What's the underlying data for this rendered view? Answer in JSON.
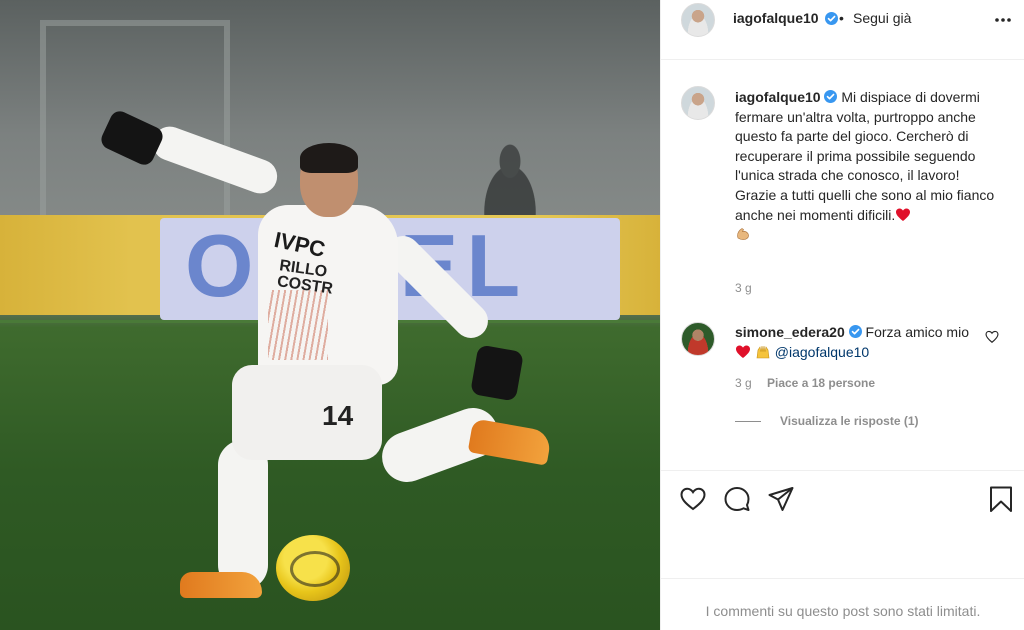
{
  "post": {
    "photo": {
      "banner_text": "OLGEL",
      "shirt_sponsor": "IVPC",
      "shirt_sponsor2": "RILLO\nCOSTR",
      "shirt_number": "14"
    }
  },
  "header": {
    "username": "iagofalque10",
    "separator": "•",
    "follow_label": "Segui già",
    "more_icon": "more-horizontal-icon"
  },
  "caption": {
    "username": "iagofalque10",
    "text": "Mi dispiace di dovermi fermare un'altra volta, purtroppo anche questo fa parte del gioco. Cercherò di recuperare il prima possibile seguendo l'unica strada che conosco, il lavoro!\nGrazie a tutti quelli che sono al mio fianco anche nei momenti dificili.",
    "emojis": [
      "red-heart-emoji",
      "flexed-biceps-emoji"
    ],
    "time": "3 g"
  },
  "comments": [
    {
      "username": "simone_edera20",
      "text": "Forza amico mio",
      "mention": "@iagofalque10",
      "emojis": [
        "red-heart-emoji",
        "raising-hands-emoji"
      ],
      "time": "3 g",
      "likes": "Piace a 18 persone",
      "replies": "Visualizza le risposte (1)"
    }
  ],
  "actions": {
    "like_icon": "heart-icon",
    "comment_icon": "comment-icon",
    "share_icon": "share-icon",
    "save_icon": "bookmark-icon"
  },
  "footer": {
    "limited_text": "I commenti su questo post sono stati limitati."
  },
  "colors": {
    "verified": "#3897f0",
    "text": "#262626",
    "muted": "#8e8e8e",
    "mention": "#00376b",
    "heart_emoji": "#e0102a"
  }
}
